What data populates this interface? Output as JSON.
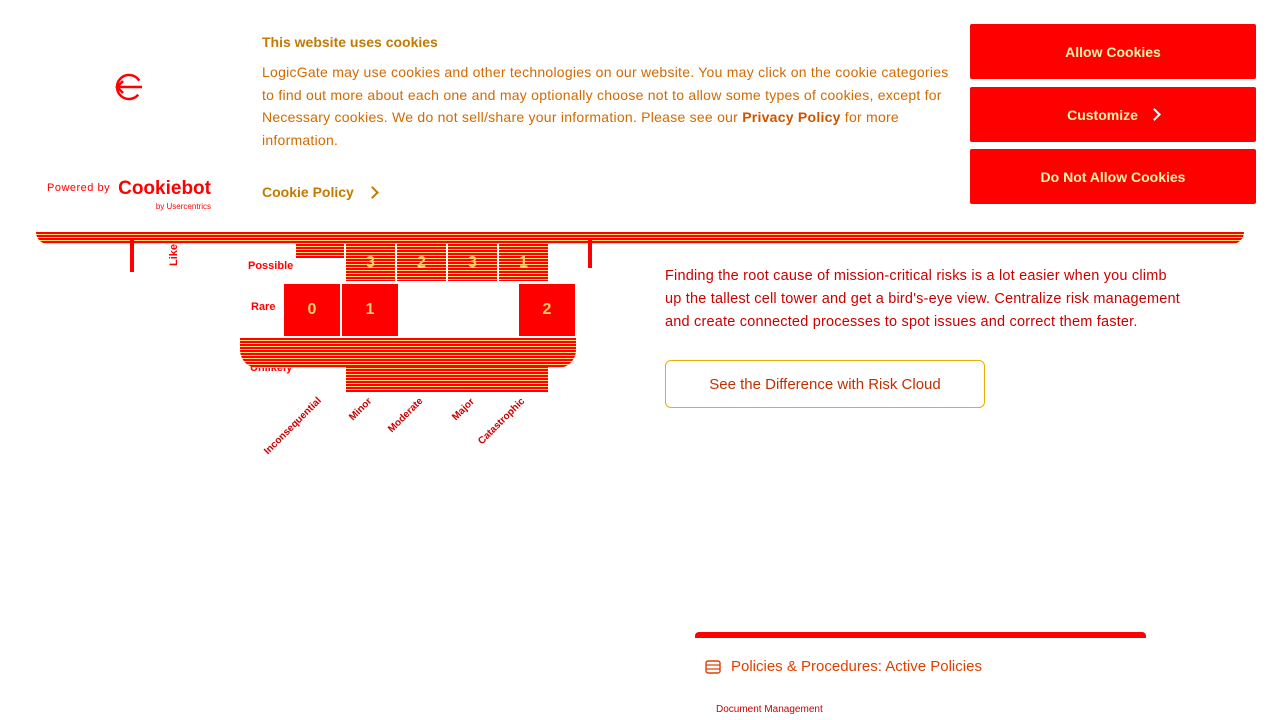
{
  "cookie_banner": {
    "title": "This website uses cookies",
    "text_before_link": "LogicGate may use cookies and other technologies on our website. You may click on the cookie categories to find out more about each one and may optionally choose not to allow some types of cookies, except for Necessary cookies.  We do not sell/share your information. Please see our ",
    "privacy_link": "Privacy Policy",
    "text_after_link": " for more information.",
    "cookie_policy_link": "Cookie Policy",
    "powered_by": "Powered by",
    "brand": "Cookiebot",
    "brand_sub": "by Usercentrics",
    "buttons": {
      "allow": "Allow Cookies",
      "customize": "Customize",
      "deny": "Do Not Allow Cookies"
    }
  },
  "matrix": {
    "y_axis_label": "Likelihood",
    "rows": [
      "Possible",
      "Rare",
      "Unlikely"
    ],
    "possible_values": [
      "3",
      "2",
      "3",
      "1"
    ],
    "rare_values": [
      "0",
      "1",
      "",
      "2"
    ],
    "columns": [
      "Inconsequential",
      "Minor",
      "Moderate",
      "Major",
      "Catastrophic"
    ]
  },
  "content": {
    "paragraph": "Finding the root cause of mission-critical risks is a lot easier when you climb up the tallest cell tower and get a bird's-eye view. Centralize risk management and create connected processes to spot issues and correct them faster.",
    "cta_label": "See the Difference with Risk Cloud"
  },
  "card": {
    "title": "Policies & Procedures: Active Policies",
    "subtitle": "Document Management"
  },
  "colors": {
    "primary_red": "#ff0000",
    "accent_yellow": "#ffe066"
  }
}
